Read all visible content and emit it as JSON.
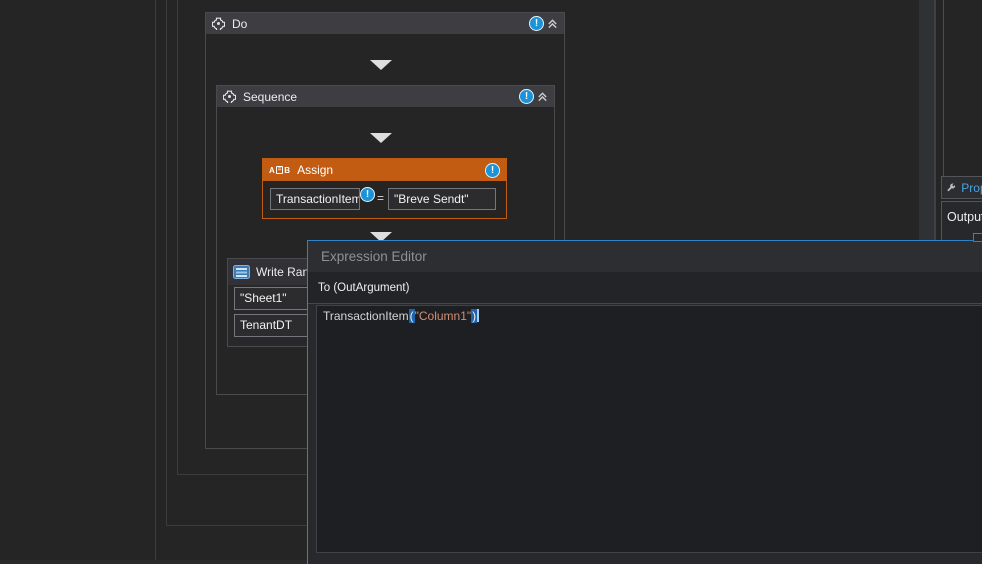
{
  "designer": {
    "do_activity": {
      "title": "Do"
    },
    "sequence_activity": {
      "title": "Sequence"
    },
    "assign_activity": {
      "title": "Assign",
      "badge": {
        "a": "A",
        "eq": "=",
        "b": "B"
      },
      "to_field_value": "TransactionItem",
      "operator": "=",
      "value_field_value": "\"Breve Sendt\""
    },
    "write_range_activity": {
      "title": "Write Range",
      "sheet_field_value": "\"Sheet1\"",
      "datatable_field_value": "TenantDT"
    },
    "validation_mark": "!"
  },
  "properties_panel": {
    "title": "Properties",
    "output_section_label": "Output"
  },
  "expression_editor": {
    "title": "Expression Editor",
    "argument_label": "To (OutArgument)",
    "expression": {
      "identifier": "TransactionItem",
      "open_paren": "(",
      "string_literal": "\"Column1\"",
      "close_paren": ")"
    }
  },
  "colors": {
    "canvas_background": "#252526",
    "activity_header_gray": "#3e3e42",
    "assign_accent_orange": "#c25c12",
    "validation_blue": "#1b93d8",
    "dialog_border_blue": "#2e82c5",
    "string_literal_color": "#d08f74",
    "bracket_match_blue": "#2063a8",
    "properties_title_blue": "#4aa3e2"
  }
}
